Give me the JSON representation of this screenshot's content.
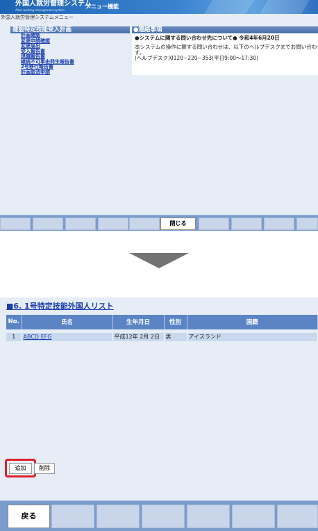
{
  "header": {
    "title": "外国人就労管理システム",
    "subtitle": "Alien working management system",
    "menu_label": "メニュー機能"
  },
  "breadcrumb": "外国人就労管理システムメニュー",
  "left_panel": {
    "heading": "建設特定技能受入計画",
    "items": [
      "計画確認",
      "変更申請確認",
      "変更届出",
      "受入報告書",
      "退職報告書",
      "継続不可事由発生報告書",
      "2号移行報告書",
      "計画取消申請"
    ]
  },
  "notice": {
    "heading": "●連絡事項",
    "title": "●システムに関する問い合わせ先について● 令和4年6月20日",
    "lines": [
      "本システムの操作に関する問い合わせは、以下のヘルプデスクまでお問い合わせ下さい",
      "す。",
      "(ヘルプデスク)0120−220−353(平日9:00〜17:30)"
    ]
  },
  "top_footer": {
    "close_label": "閉じる"
  },
  "list": {
    "title": "■6. 1号特定技能外国人リスト",
    "columns": [
      "No.",
      "氏名",
      "生年月日",
      "性別",
      "国籍"
    ],
    "rows": [
      {
        "no": "1",
        "name": "ABCD EFG",
        "birthdate": "平成12年 2月 2日",
        "sex": "男",
        "nationality": "アイスランド"
      }
    ]
  },
  "buttons": {
    "add": "追加",
    "delete": "削除",
    "back": "戻る"
  },
  "colors": {
    "header_blue": "#1d63b5",
    "highlight": "#e0202a",
    "footer": "#7a9ccd",
    "table_header": "#5b84c4"
  }
}
